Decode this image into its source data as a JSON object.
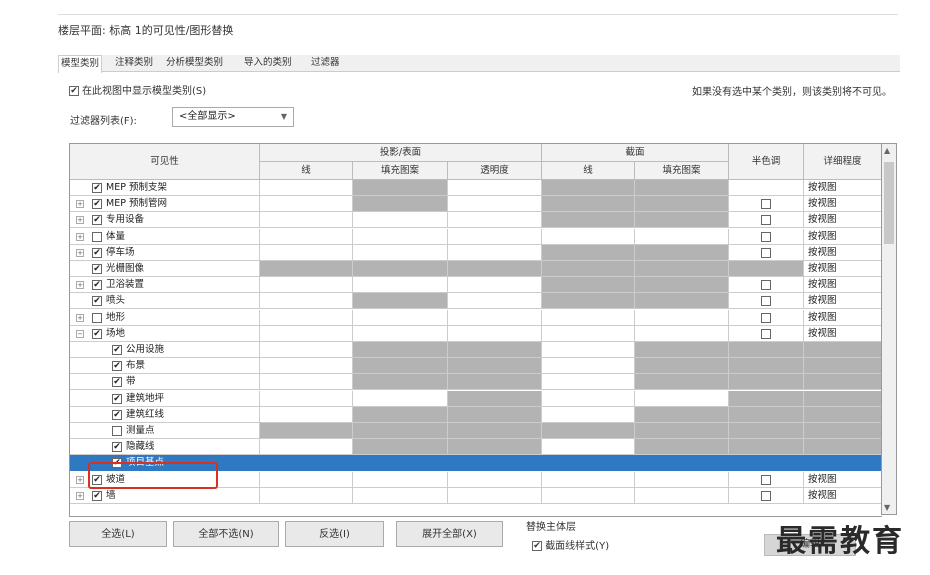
{
  "window_title": "楼层平面: 标高 1的可见性/图形替换",
  "tabs": [
    "模型类别",
    "注释类别",
    "分析模型类别",
    "导入的类别",
    "过滤器"
  ],
  "show_model_categories_label": "在此视图中显示模型类别(S)",
  "hint": "如果没有选中某个类别，则该类别将不可见。",
  "filter_list_label": "过滤器列表(F):",
  "filter_list_value": "<全部显示>",
  "headers": {
    "visibility": "可见性",
    "proj": "投影/表面",
    "cut": "截面",
    "line": "线",
    "fill": "填充图案",
    "trans": "透明度",
    "cut_line": "线",
    "cut_fill": "填充图案",
    "halftone": "半色调",
    "detail": "详细程度"
  },
  "rows": [
    {
      "name": "MEP 预制支架",
      "check": "✔",
      "exp": "",
      "lvl": 0,
      "pat": "WGWGGW",
      "ht": "",
      "detail": "按视图"
    },
    {
      "name": "MEP 预制管网",
      "check": "✔",
      "exp": "+",
      "lvl": 0,
      "pat": "WGWGGW",
      "ht": "□",
      "detail": "按视图"
    },
    {
      "name": "专用设备",
      "check": "✔",
      "exp": "+",
      "lvl": 0,
      "pat": "WWWGGW",
      "ht": "□",
      "detail": "按视图"
    },
    {
      "name": "体量",
      "check": "□",
      "exp": "+",
      "lvl": 0,
      "pat": "WWWWWW",
      "ht": "□",
      "detail": "按视图"
    },
    {
      "name": "停车场",
      "check": "✔",
      "exp": "+",
      "lvl": 0,
      "pat": "WWWGGW",
      "ht": "□",
      "detail": "按视图"
    },
    {
      "name": "光栅图像",
      "check": "✔",
      "exp": "",
      "lvl": 0,
      "pat": "GGGGGG",
      "ht": "",
      "detail": "按视图"
    },
    {
      "name": "卫浴装置",
      "check": "✔",
      "exp": "+",
      "lvl": 0,
      "pat": "WWWGGW",
      "ht": "□",
      "detail": "按视图"
    },
    {
      "name": "喷头",
      "check": "✔",
      "exp": "",
      "lvl": 0,
      "pat": "WGWGGW",
      "ht": "□",
      "detail": "按视图"
    },
    {
      "name": "地形",
      "check": "□",
      "exp": "+",
      "lvl": 0,
      "pat": "WWWWWW",
      "ht": "□",
      "detail": "按视图"
    },
    {
      "name": "场地",
      "check": "✔",
      "exp": "−",
      "lvl": 0,
      "pat": "WWWWWW",
      "ht": "□",
      "detail": "按视图"
    },
    {
      "name": "公用设施",
      "check": "✔",
      "exp": "",
      "lvl": 1,
      "pat": "WGGWGG",
      "ht": "",
      "detail": ""
    },
    {
      "name": "布景",
      "check": "✔",
      "exp": "",
      "lvl": 1,
      "pat": "WGGWGG",
      "ht": "",
      "detail": ""
    },
    {
      "name": "带",
      "check": "✔",
      "exp": "",
      "lvl": 1,
      "pat": "WGGWGG",
      "ht": "",
      "detail": ""
    },
    {
      "name": "建筑地坪",
      "check": "✔",
      "exp": "",
      "lvl": 1,
      "pat": "WWGWWG",
      "ht": "",
      "detail": ""
    },
    {
      "name": "建筑红线",
      "check": "✔",
      "exp": "",
      "lvl": 1,
      "pat": "WGGWGG",
      "ht": "",
      "detail": ""
    },
    {
      "name": "测量点",
      "check": "□",
      "exp": "",
      "lvl": 1,
      "pat": "GGGGGG",
      "ht": "",
      "detail": ""
    },
    {
      "name": "隐藏线",
      "check": "✔",
      "exp": "",
      "lvl": 1,
      "pat": "WGGWGG",
      "ht": "",
      "detail": ""
    },
    {
      "name": "项目基点",
      "check": "✔",
      "exp": "",
      "lvl": 1,
      "pat": "WWWWWW",
      "ht": "",
      "detail": "",
      "selected": true
    },
    {
      "name": "坡道",
      "check": "✔",
      "exp": "+",
      "lvl": 0,
      "pat": "WWWWWW",
      "ht": "□",
      "detail": "按视图"
    },
    {
      "name": "墙",
      "check": "✔",
      "exp": "+",
      "lvl": 0,
      "pat": "WWWWWW",
      "ht": "□",
      "detail": "按视图"
    }
  ],
  "buttons": {
    "select_all": "全选(L)",
    "select_none": "全部不选(N)",
    "invert": "反选(I)",
    "expand_all": "展开全部(X)"
  },
  "override_host": "替换主体层",
  "cut_line_styles": "截面线样式(Y)",
  "edit_button": "编辑",
  "watermark": "最需教育"
}
